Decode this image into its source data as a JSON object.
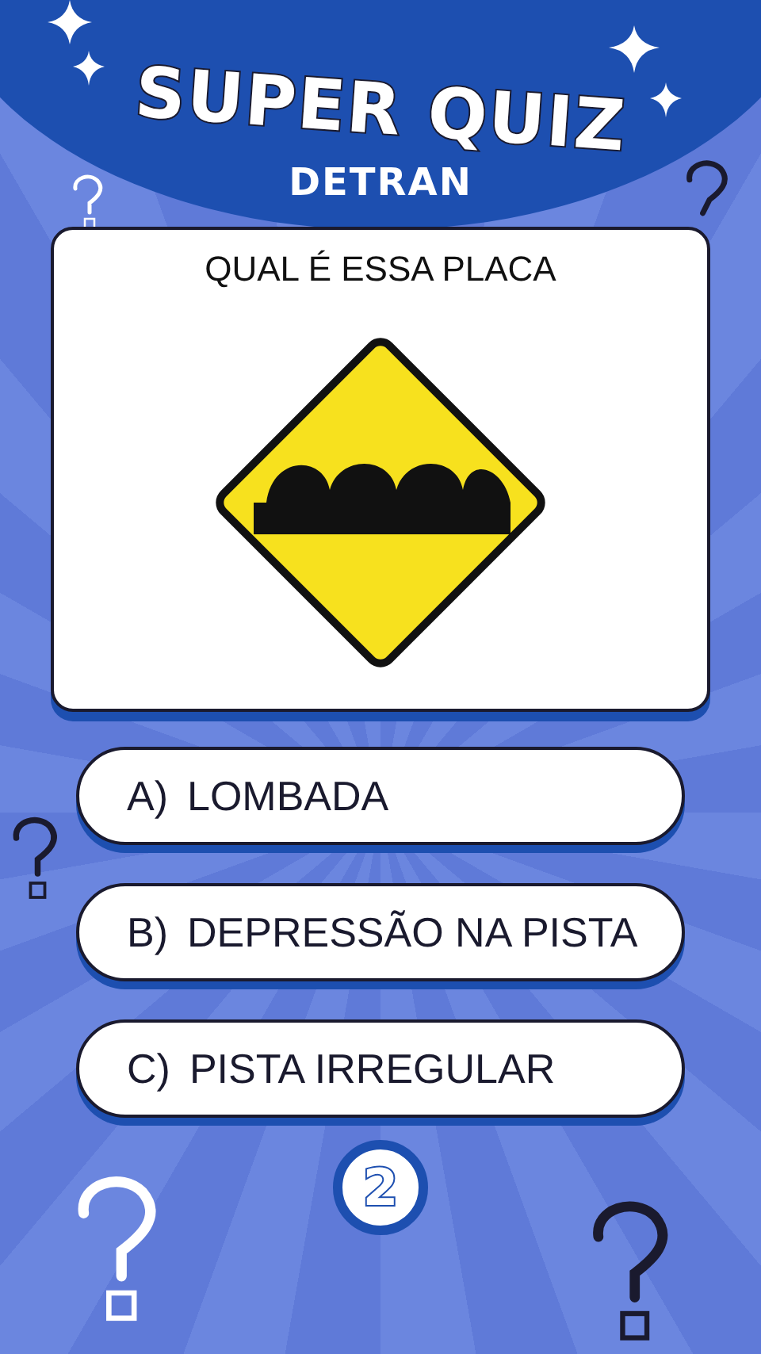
{
  "header": {
    "title": "SUPER QUIZ",
    "subtitle": "DETRAN"
  },
  "question": {
    "text": "QUAL É ESSA PLACA"
  },
  "options": [
    {
      "letter": "A)",
      "text": "LOMBADA"
    },
    {
      "letter": "B)",
      "text": "DEPRESSÃO NA PISTA"
    },
    {
      "letter": "C)",
      "text": "PISTA IRREGULAR"
    }
  ],
  "timer": "2"
}
